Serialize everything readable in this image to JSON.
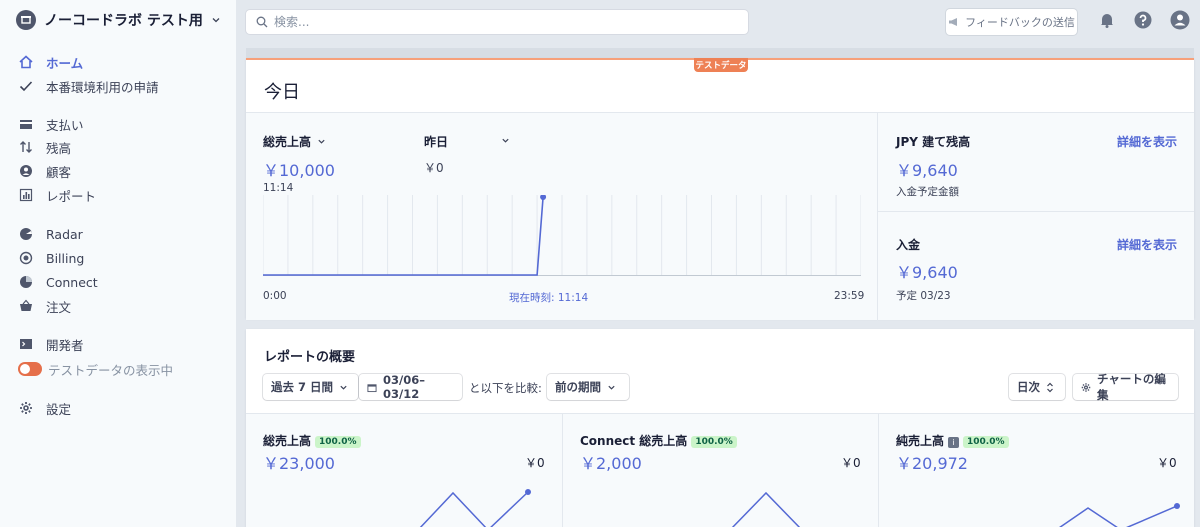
{
  "account": {
    "name": "ノーコードラボ テスト用"
  },
  "search": {
    "placeholder": "検索..."
  },
  "topbar": {
    "feedback_label": "フィードバックの送信"
  },
  "nav": {
    "home": "ホーム",
    "activate": "本番環境利用の申請",
    "payments": "支払い",
    "balance": "残高",
    "customers": "顧客",
    "reports": "レポート",
    "radar": "Radar",
    "billing": "Billing",
    "connect": "Connect",
    "orders": "注文",
    "developers": "開発者",
    "test_data": "テストデータの表示中",
    "settings": "設定"
  },
  "today": {
    "badge": "テストデータ",
    "title": "今日",
    "gross_label": "総売上高",
    "gross_value": "￥10,000",
    "time": "11:14",
    "yesterday_label": "昨日",
    "yesterday_value": "￥0",
    "axis_start": "0:00",
    "axis_now": "現在時刻: 11:14",
    "axis_end": "23:59",
    "jpy_label": "JPY 建て残高",
    "jpy_value": "￥9,640",
    "jpy_sub": "入金予定金額",
    "payout_label": "入金",
    "payout_value": "￥9,640",
    "payout_sub": "予定 03/23",
    "detail_link": "詳細を表示"
  },
  "report": {
    "title": "レポートの概要",
    "range": "過去 7 日間",
    "dates": "03/06–03/12",
    "compare_text": "と以下を比較:",
    "compare_value": "前の期間",
    "interval": "日次",
    "edit_chart": "チャートの編集",
    "metrics": [
      {
        "label": "総売上高",
        "pct": "100.0%",
        "value": "￥23,000",
        "prev": "￥0"
      },
      {
        "label": "Connect 総売上高",
        "pct": "100.0%",
        "value": "￥2,000",
        "prev": "￥0"
      },
      {
        "label": "純売上高",
        "pct": "100.0%",
        "value": "￥20,972",
        "prev": "￥0"
      }
    ]
  },
  "colors": {
    "accent": "#5469d4",
    "test_orange": "#ee8155",
    "sidebar_bg": "#f7fafc"
  },
  "chart_data": {
    "type": "line",
    "title": "",
    "x": [
      "0:00",
      "11:14"
    ],
    "series": [
      {
        "values": [
          0,
          10000
        ]
      }
    ],
    "xlabel": "",
    "ylabel": "",
    "xrange": [
      "0:00",
      "23:59"
    ],
    "grid": true
  }
}
